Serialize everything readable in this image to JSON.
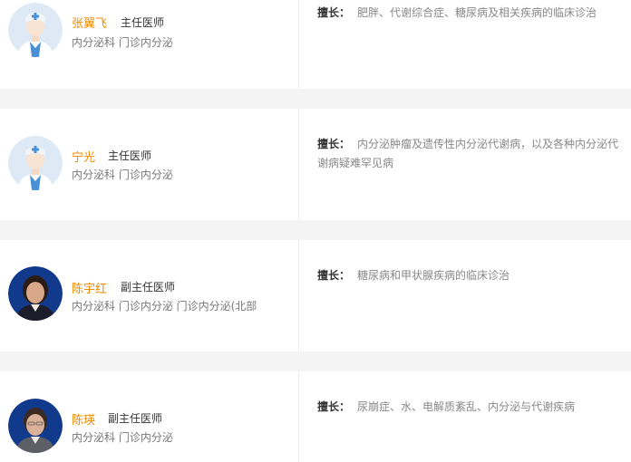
{
  "doctors": [
    {
      "name": "张翼飞",
      "title": "主任医师",
      "dept": "内分泌科 门诊内分泌",
      "specialty_label": "擅长：",
      "specialty": "肥胖、代谢综合症、糖尿病及相关疾病的临床诊治",
      "avatar": "default-doctor-icon"
    },
    {
      "name": "宁光",
      "title": "主任医师",
      "dept": "内分泌科 门诊内分泌",
      "specialty_label": "擅长：",
      "specialty": "内分泌肿瘤及遗传性内分泌代谢病，以及各种内分泌代谢病疑难罕见病",
      "avatar": "default-doctor-icon"
    },
    {
      "name": "陈宇红",
      "title": "副主任医师",
      "dept": "内分泌科 门诊内分泌 门诊内分泌(北部",
      "specialty_label": "擅长：",
      "specialty": "糖尿病和甲状腺疾病的临床诊治",
      "avatar": "doctor-photo"
    },
    {
      "name": "陈瑛",
      "title": "副主任医师",
      "dept": "内分泌科 门诊内分泌",
      "specialty_label": "擅长：",
      "specialty": "尿崩症、水、电解质紊乱、内分泌与代谢疾病",
      "avatar": "doctor-photo"
    }
  ],
  "colors": {
    "name": "#f08a00",
    "accent_blue": "#4a90d9",
    "avatar_bg": "#ddeaf6"
  }
}
